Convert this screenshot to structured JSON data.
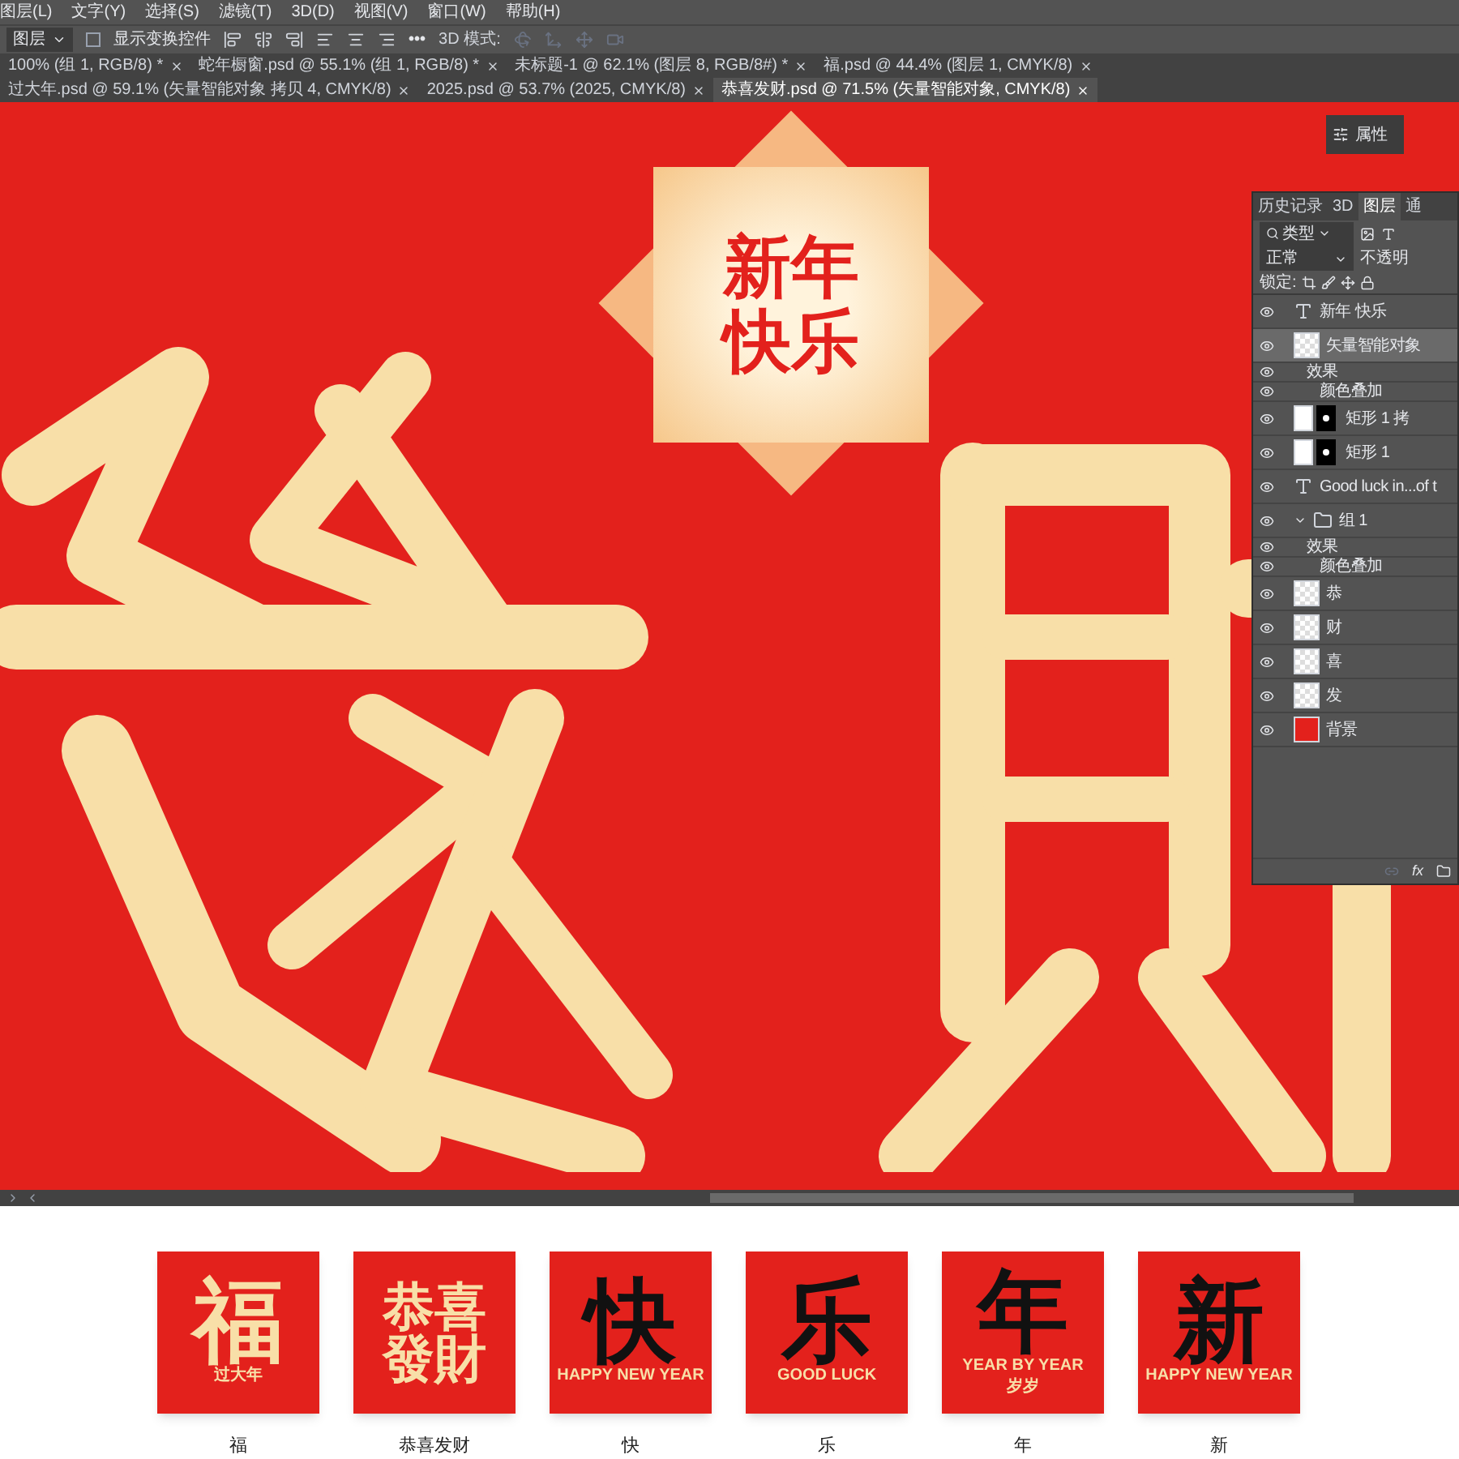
{
  "menu": [
    "图层(L)",
    "文字(Y)",
    "选择(S)",
    "滤镜(T)",
    "3D(D)",
    "视图(V)",
    "窗口(W)",
    "帮助(H)"
  ],
  "options_bar": {
    "target": "图层",
    "transform_controls": {
      "label": "显示变换控件",
      "checked": false
    },
    "more": "•••",
    "mode_label": "3D 模式:"
  },
  "document_tabs": [
    {
      "label": "100% (组 1, RGB/8) *",
      "selected": false
    },
    {
      "label": "蛇年橱窗.psd @ 55.1% (组 1, RGB/8) *",
      "selected": false
    },
    {
      "label": "未标题-1 @ 62.1% (图层 8, RGB/8#) *",
      "selected": false
    },
    {
      "label": "福.psd @ 44.4% (图层 1, CMYK/8)",
      "selected": false
    },
    {
      "label": "过大年.psd @ 59.1% (矢量智能对象 拷贝 4, CMYK/8)",
      "selected": false
    },
    {
      "label": "2025.psd @ 53.7% (2025, CMYK/8)",
      "selected": false
    },
    {
      "label": "恭喜发财.psd @ 71.5% (矢量智能对象, CMYK/8)",
      "selected": true
    }
  ],
  "canvas": {
    "badge_lines": [
      "新年",
      "快乐"
    ]
  },
  "properties_panel": {
    "label": "属性"
  },
  "layers_panel": {
    "tabs": [
      {
        "label": "历史记录",
        "selected": false
      },
      {
        "label": "3D",
        "selected": false
      },
      {
        "label": "图层",
        "selected": true
      },
      {
        "label": "通",
        "selected": false
      }
    ],
    "filter": "类型",
    "blend_mode": "正常",
    "opacity_label": "不透明",
    "lock_label": "锁定:",
    "effects_button": "fx",
    "layers": [
      {
        "kind": "text",
        "name": "新年 快乐",
        "visible": true,
        "selected": false
      },
      {
        "kind": "smart",
        "name": "矢量智能对象",
        "visible": true,
        "selected": true
      },
      {
        "kind": "effect",
        "name": "效果",
        "visible": true,
        "selected": false
      },
      {
        "kind": "sub",
        "name": "颜色叠加",
        "visible": true,
        "selected": false
      },
      {
        "kind": "masked",
        "name": "矩形 1 拷",
        "visible": true,
        "selected": false
      },
      {
        "kind": "masked",
        "name": "矩形 1",
        "visible": true,
        "selected": false
      },
      {
        "kind": "text",
        "name": "Good luck in...of t",
        "visible": true,
        "selected": false
      },
      {
        "kind": "group",
        "name": "组 1",
        "visible": true,
        "selected": false
      },
      {
        "kind": "effect",
        "name": "效果",
        "visible": true,
        "selected": false
      },
      {
        "kind": "sub",
        "name": "颜色叠加",
        "visible": true,
        "selected": false
      },
      {
        "kind": "pixel",
        "name": "恭",
        "visible": true,
        "selected": false
      },
      {
        "kind": "pixel",
        "name": "财",
        "visible": true,
        "selected": false
      },
      {
        "kind": "pixel",
        "name": "喜",
        "visible": true,
        "selected": false
      },
      {
        "kind": "pixel",
        "name": "发",
        "visible": true,
        "selected": false
      },
      {
        "kind": "fill",
        "name": "背景",
        "visible": true,
        "selected": false
      }
    ]
  },
  "gallery": [
    {
      "glyphs": [
        "福"
      ],
      "color": "#f8dfa8",
      "extras": [
        "过大年"
      ],
      "caption": "福"
    },
    {
      "glyphs": [
        "恭喜",
        "發財"
      ],
      "color": "#f8dfa8",
      "caption": "恭喜发财"
    },
    {
      "glyphs": [
        "快"
      ],
      "color": "#111111",
      "extras": [
        "HAPPY NEW YEAR"
      ],
      "caption": "快"
    },
    {
      "glyphs": [
        "乐"
      ],
      "color": "#111111",
      "extras": [
        "GOOD LUCK"
      ],
      "caption": "乐"
    },
    {
      "glyphs": [
        "年"
      ],
      "color": "#111111",
      "extras": [
        "YEAR BY YEAR",
        "岁岁"
      ],
      "caption": "年"
    },
    {
      "glyphs": [
        "新"
      ],
      "color": "#111111",
      "extras": [
        "HAPPY NEW YEAR"
      ],
      "caption": "新"
    }
  ]
}
